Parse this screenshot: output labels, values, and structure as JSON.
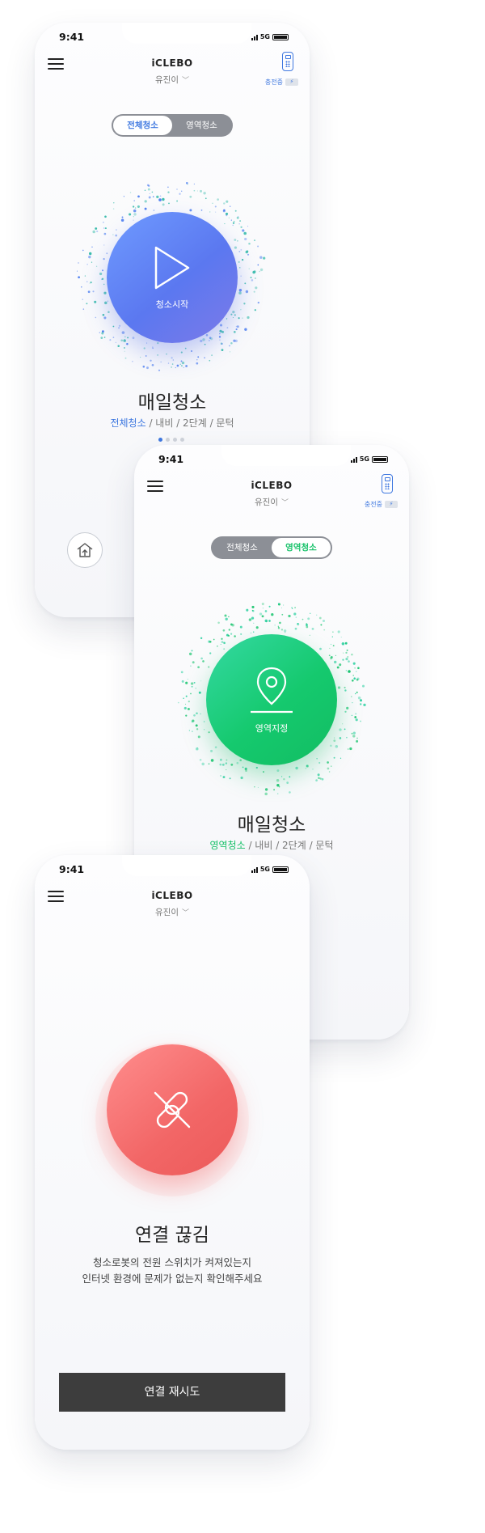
{
  "screens": [
    {
      "status": {
        "time": "9:41",
        "network": "5G"
      },
      "header": {
        "brand": "iCLEBO",
        "user": "유진이",
        "charge_label": "충전중"
      },
      "toggle": [
        "전체청소",
        "영역청소"
      ],
      "main": {
        "circle_label": "청소시작",
        "title": "매일청소",
        "sub_highlight": "전체청소",
        "sub_rest": " / 내비 / 2단계 / 문턱"
      },
      "accent": "#3f78e0"
    },
    {
      "status": {
        "time": "9:41",
        "network": "5G"
      },
      "header": {
        "brand": "iCLEBO",
        "user": "유진이",
        "charge_label": "충전중"
      },
      "toggle": [
        "전체청소",
        "영역청소"
      ],
      "main": {
        "circle_label": "영역지정",
        "title": "매일청소",
        "sub_highlight": "영역청소",
        "sub_rest": " / 내비 / 2단계 / 문턱"
      },
      "accent": "#18c26a"
    },
    {
      "status": {
        "time": "9:41",
        "network": "5G"
      },
      "header": {
        "brand": "iCLEBO",
        "user": "유진이"
      },
      "main": {
        "title": "연결 끊김",
        "message_line1": "청소로봇의 전원 스위치가 켜져있는지",
        "message_line2": "인터넷 환경에 문제가 없는지 확인해주세요"
      },
      "retry_label": "연결 재시도",
      "accent": "#f26666"
    }
  ],
  "icons": {
    "menu": "hamburger-icon",
    "remote": "remote-control-icon",
    "bolt": "lightning-icon",
    "play": "play-icon",
    "pin": "map-pin-icon",
    "unlink": "broken-link-icon",
    "home": "home-icon",
    "chevron": "chevron-down-icon"
  }
}
